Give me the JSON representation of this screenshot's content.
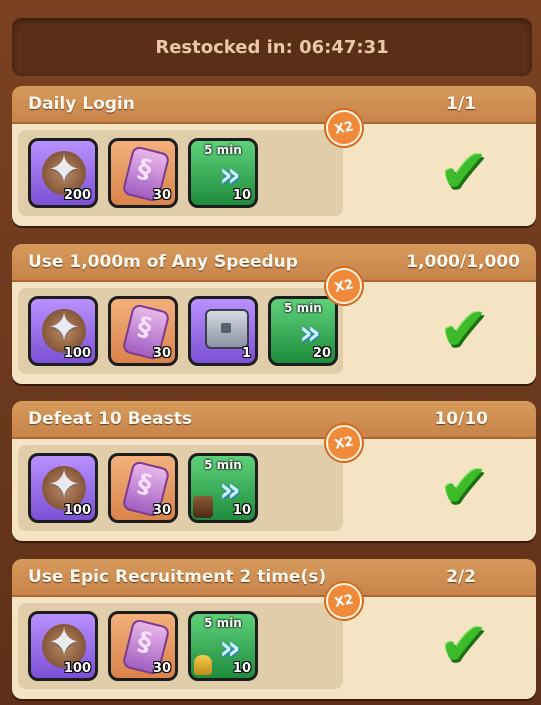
{
  "restock": {
    "label": "Restocked in: 06:47:31"
  },
  "double_badge": "X2",
  "quests": [
    {
      "title": "Daily Login",
      "progress": "1/1",
      "rewards": [
        {
          "kind": "shuriken",
          "qty": "200"
        },
        {
          "kind": "rune",
          "qty": "30"
        },
        {
          "kind": "speedup",
          "label": "5 min",
          "qty": "10"
        }
      ]
    },
    {
      "title": "Use 1,000m of Any Speedup",
      "progress": "1,000/1,000",
      "rewards": [
        {
          "kind": "shuriken",
          "qty": "100"
        },
        {
          "kind": "rune",
          "qty": "30"
        },
        {
          "kind": "chest",
          "qty": "1"
        },
        {
          "kind": "speedup",
          "label": "5 min",
          "qty": "20"
        }
      ]
    },
    {
      "title": "Defeat 10 Beasts",
      "progress": "10/10",
      "rewards": [
        {
          "kind": "shuriken",
          "qty": "100"
        },
        {
          "kind": "rune",
          "qty": "30"
        },
        {
          "kind": "speedup",
          "label": "5 min",
          "qty": "10"
        }
      ]
    },
    {
      "title": "Use Epic Recruitment 2 time(s)",
      "progress": "2/2",
      "rewards": [
        {
          "kind": "shuriken",
          "qty": "100"
        },
        {
          "kind": "rune",
          "qty": "30"
        },
        {
          "kind": "speedup",
          "label": "5 min",
          "qty": "10"
        }
      ]
    }
  ]
}
